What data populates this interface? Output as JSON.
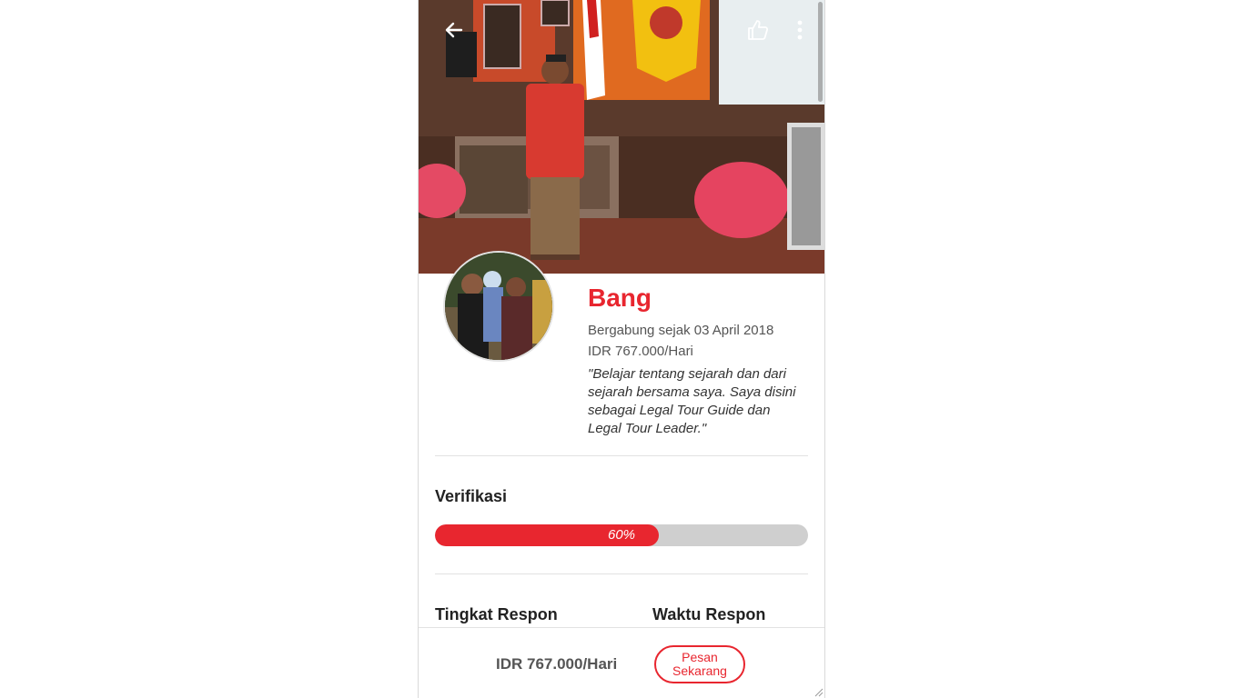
{
  "profile": {
    "name": "Bang",
    "joined": "Bergabung sejak 03 April 2018",
    "price": "IDR 767.000/Hari",
    "quote": "\"Belajar tentang sejarah dan dari sejarah bersama saya. Saya disini sebagai Legal Tour Guide dan Legal Tour Leader.\""
  },
  "verification": {
    "title": "Verifikasi",
    "progress_label": "60%",
    "progress_value": 60
  },
  "stats": {
    "response_rate_label": "Tingkat Respon",
    "response_time_label": "Waktu Respon"
  },
  "bottom_bar": {
    "price": "IDR 767.000/Hari",
    "order_button": "Pesan Sekarang"
  },
  "icons": {
    "back": "arrow-left-icon",
    "like": "thumbs-up-icon",
    "more": "more-vertical-icon"
  },
  "colors": {
    "accent": "#e8262f",
    "progress_track": "#cfcfcf"
  }
}
